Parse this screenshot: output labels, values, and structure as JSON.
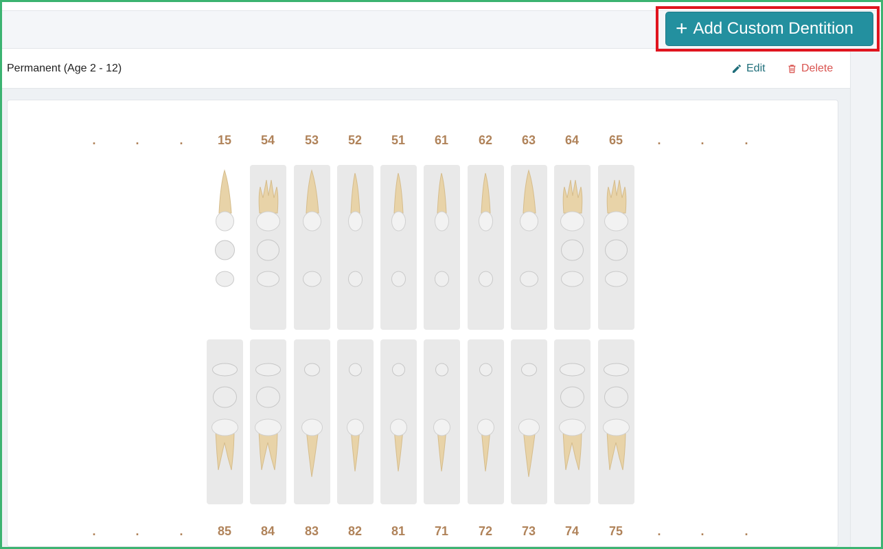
{
  "toolbar": {
    "add_button_label": "Add Custom Dentition",
    "add_icon": "plus-icon"
  },
  "dentition": {
    "title": "Permanent (Age 2 - 12)",
    "edit_label": "Edit",
    "delete_label": "Delete",
    "edit_icon": "pencil-icon",
    "delete_icon": "trash-icon"
  },
  "chart": {
    "upper_labels": [
      ".",
      ".",
      ".",
      "15",
      "54",
      "53",
      "52",
      "51",
      "61",
      "62",
      "63",
      "64",
      "65",
      ".",
      ".",
      "."
    ],
    "lower_labels": [
      ".",
      ".",
      ".",
      "85",
      "84",
      "83",
      "82",
      "81",
      "71",
      "72",
      "73",
      "74",
      "75",
      ".",
      ".",
      "."
    ],
    "upper_teeth": [
      {
        "id": "15",
        "type": "premolar",
        "highlighted": false
      },
      {
        "id": "54",
        "type": "molar",
        "highlighted": true
      },
      {
        "id": "53",
        "type": "canine",
        "highlighted": true
      },
      {
        "id": "52",
        "type": "incisor",
        "highlighted": true
      },
      {
        "id": "51",
        "type": "incisor",
        "highlighted": true
      },
      {
        "id": "61",
        "type": "incisor",
        "highlighted": true
      },
      {
        "id": "62",
        "type": "incisor",
        "highlighted": true
      },
      {
        "id": "63",
        "type": "canine",
        "highlighted": true
      },
      {
        "id": "64",
        "type": "molar",
        "highlighted": true
      },
      {
        "id": "65",
        "type": "molar",
        "highlighted": true
      }
    ],
    "lower_teeth": [
      {
        "id": "85",
        "type": "molar",
        "highlighted": true
      },
      {
        "id": "84",
        "type": "molar",
        "highlighted": true
      },
      {
        "id": "83",
        "type": "canine",
        "highlighted": true
      },
      {
        "id": "82",
        "type": "incisor",
        "highlighted": true
      },
      {
        "id": "81",
        "type": "incisor",
        "highlighted": true
      },
      {
        "id": "71",
        "type": "incisor",
        "highlighted": true
      },
      {
        "id": "72",
        "type": "incisor",
        "highlighted": true
      },
      {
        "id": "73",
        "type": "canine",
        "highlighted": true
      },
      {
        "id": "74",
        "type": "molar",
        "highlighted": true
      },
      {
        "id": "75",
        "type": "molar",
        "highlighted": true
      }
    ],
    "colors": {
      "label": "#b0835a",
      "slot": "#e9e9e9",
      "root": "#e8d3a8",
      "crown": "#f2f2f2"
    }
  }
}
